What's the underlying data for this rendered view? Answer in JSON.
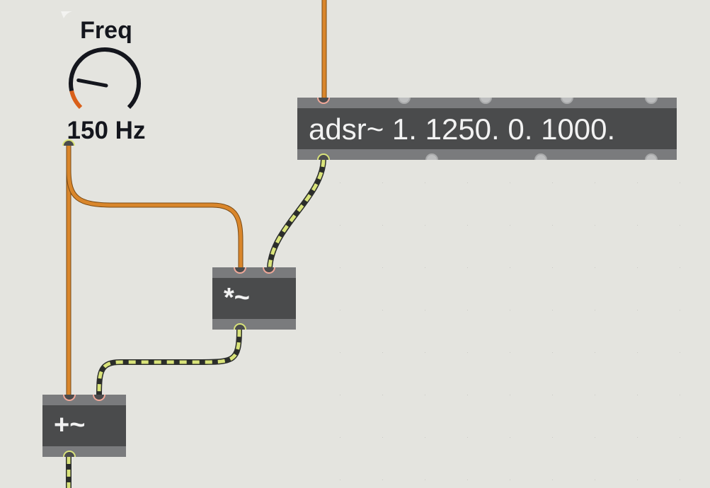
{
  "dial": {
    "title": "Freq",
    "value_text": "150 Hz",
    "level_fraction": 0.12,
    "accent_color": "#d9601a",
    "arc_color": "#14161d"
  },
  "objects": {
    "adsr": {
      "text": "adsr~ 1. 1250. 0. 1000."
    },
    "mul": {
      "text": "*~"
    },
    "add": {
      "text": "+~"
    }
  },
  "colors": {
    "canvas": "#e4e4df",
    "object_body": "#4a4b4c",
    "object_strip": "#7a7b7d",
    "control_cord": "#d9862b",
    "signal_cord_dash": "#d9e37a",
    "signal_cord_base": "#2b2d2b"
  }
}
